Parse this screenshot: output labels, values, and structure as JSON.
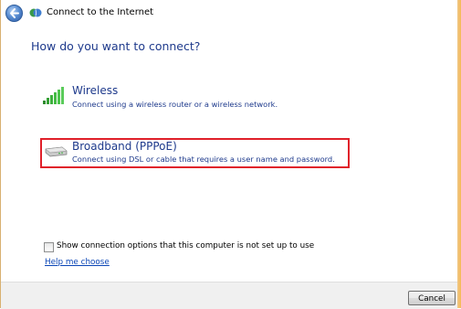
{
  "window": {
    "title": "Connect to the Internet"
  },
  "main": {
    "heading": "How do you want to connect?",
    "options": [
      {
        "title": "Wireless",
        "description": "Connect using a wireless router or a wireless network.",
        "icon": "signal-bars-icon"
      },
      {
        "title": "Broadband (PPPoE)",
        "description": "Connect using DSL or cable that requires a user name and password.",
        "icon": "modem-icon"
      }
    ],
    "show_options_label": "Show connection options that this computer is not set up to use",
    "show_options_checked": false,
    "help_link": "Help me choose"
  },
  "footer": {
    "cancel_label": "Cancel"
  },
  "colors": {
    "heading": "#1e3a8c",
    "link": "#0a45b6",
    "highlight_border": "#e0202a"
  }
}
